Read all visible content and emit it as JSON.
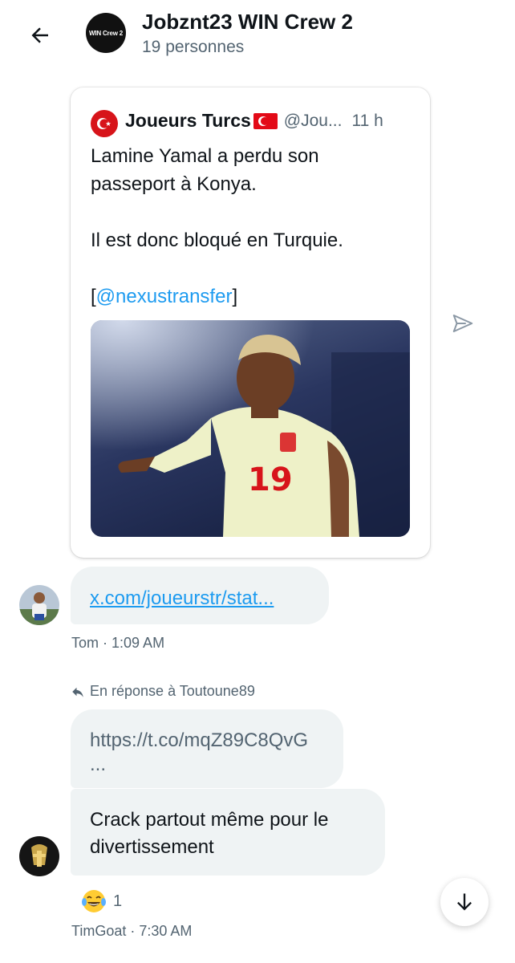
{
  "header": {
    "group_avatar_text": "WIN Crew 2",
    "title": "Jobznt23 WIN Crew 2",
    "subtitle": "19 personnes"
  },
  "tweet": {
    "author_name": "Joueurs Turcs",
    "handle": "@Jou...",
    "time": "11 h",
    "lines": [
      "Lamine Yamal a perdu son",
      "passeport à Konya.",
      "Il est donc bloqué en Turquie."
    ],
    "mention_prefix": "[",
    "mention": "@nexustransfer",
    "mention_suffix": "]",
    "media": {
      "shirt_number": "19"
    }
  },
  "messages": {
    "tom": {
      "link": "x.com/joueurstr/stat...",
      "sender": "Tom",
      "time": "1:09 AM"
    },
    "timgoat": {
      "reply_label": "En réponse à Toutoune89",
      "url_line1": "https://t.co/mqZ89C8QvG",
      "url_line2": "...",
      "text_line1": "Crack partout même pour le",
      "text_line2": "divertissement",
      "reaction_emoji": "laughing-tears-emoji",
      "reaction_count": "1",
      "sender": "TimGoat",
      "time": "7:30 AM"
    },
    "meta_separator": " · "
  },
  "icons": {
    "back": "arrow-left-icon",
    "share": "send-icon",
    "scroll_down": "arrow-down-icon",
    "reply": "reply-arrow-icon"
  },
  "colors": {
    "link": "#1d9bf0",
    "bubble": "#eff3f4",
    "muted": "#536471"
  }
}
